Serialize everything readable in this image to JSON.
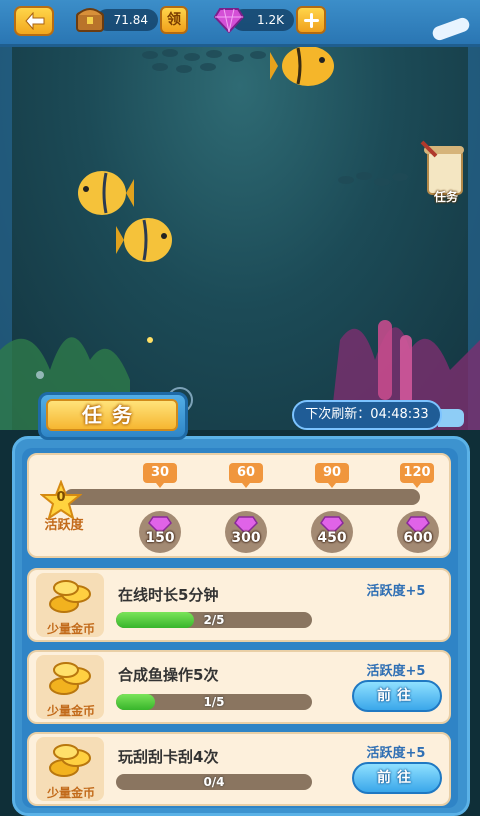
{
  "header": {
    "coins_value": "71.84",
    "claim_label": "领",
    "gems_value": "1.2K"
  },
  "side": {
    "task_button_label": "任务"
  },
  "panel": {
    "title": "任务",
    "refresh_label": "下次刷新：04:48:33"
  },
  "activity": {
    "current": "0",
    "label": "活跃度",
    "milestones": [
      "30",
      "60",
      "90",
      "120"
    ],
    "rewards": [
      "150",
      "300",
      "450",
      "600"
    ]
  },
  "tasks": [
    {
      "title": "在线时长5分钟",
      "reward": "活跃度+5",
      "icon_label": "少量金币",
      "progress_text": "2/5",
      "progress": 0.4,
      "button": ""
    },
    {
      "title": "合成鱼操作5次",
      "reward": "活跃度+5",
      "icon_label": "少量金币",
      "progress_text": "1/5",
      "progress": 0.2,
      "button": "前往"
    },
    {
      "title": "玩刮刮卡刮4次",
      "reward": "活跃度+5",
      "icon_label": "少量金币",
      "progress_text": "0/4",
      "progress": 0,
      "button": "前往"
    }
  ],
  "colors": {
    "accent_blue": "#2f84c6",
    "gold": "#f6b631",
    "progress_green": "#38b52b"
  }
}
